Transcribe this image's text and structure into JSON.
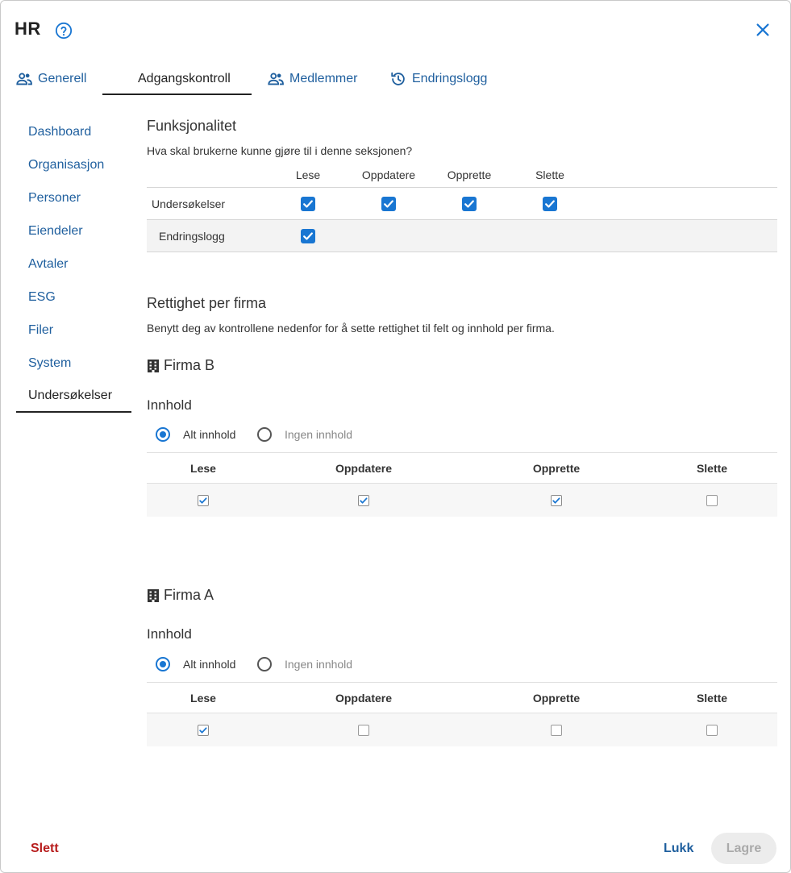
{
  "header": {
    "title": "HR"
  },
  "tabs": [
    {
      "label": "Generell",
      "icon": "people-icon"
    },
    {
      "label": "Adgangskontroll",
      "icon": ""
    },
    {
      "label": "Medlemmer",
      "icon": "people-icon"
    },
    {
      "label": "Endringslogg",
      "icon": "history-icon"
    }
  ],
  "active_tab": "Adgangskontroll",
  "sidebar": {
    "items": [
      {
        "label": "Dashboard"
      },
      {
        "label": "Organisasjon"
      },
      {
        "label": "Personer"
      },
      {
        "label": "Eiendeler"
      },
      {
        "label": "Avtaler"
      },
      {
        "label": "ESG"
      },
      {
        "label": "Filer"
      },
      {
        "label": "System"
      },
      {
        "label": "Undersøkelser"
      }
    ],
    "active": "Undersøkelser"
  },
  "functionality": {
    "heading": "Funksjonalitet",
    "question": "Hva skal brukerne kunne gjøre til i denne seksjonen?",
    "columns": [
      "Lese",
      "Oppdatere",
      "Opprette",
      "Slette"
    ],
    "rows": [
      {
        "label": "Undersøkelser",
        "checked": [
          true,
          true,
          true,
          true
        ]
      },
      {
        "label": "Endringslogg",
        "checked": [
          true
        ]
      }
    ]
  },
  "rights": {
    "heading": "Rettighet per firma",
    "description": "Benytt deg av kontrollene nedenfor for å sette rettighet til felt og innhold per firma."
  },
  "companies": [
    {
      "name": "Firma B",
      "content_label": "Innhold",
      "options": [
        "Alt innhold",
        "Ingen innhold"
      ],
      "selected_option": "Alt innhold",
      "columns": [
        "Lese",
        "Oppdatere",
        "Opprette",
        "Slette"
      ],
      "checked": [
        true,
        true,
        true,
        false
      ]
    },
    {
      "name": "Firma A",
      "content_label": "Innhold",
      "options": [
        "Alt innhold",
        "Ingen innhold"
      ],
      "selected_option": "Alt innhold",
      "columns": [
        "Lese",
        "Oppdatere",
        "Opprette",
        "Slette"
      ],
      "checked": [
        true,
        false,
        false,
        false
      ]
    }
  ],
  "footer": {
    "delete_label": "Slett",
    "close_label": "Lukk",
    "save_label": "Lagre"
  },
  "colors": {
    "accent": "#1976d2",
    "link": "#1f5f9e",
    "danger": "#b71c1c"
  }
}
